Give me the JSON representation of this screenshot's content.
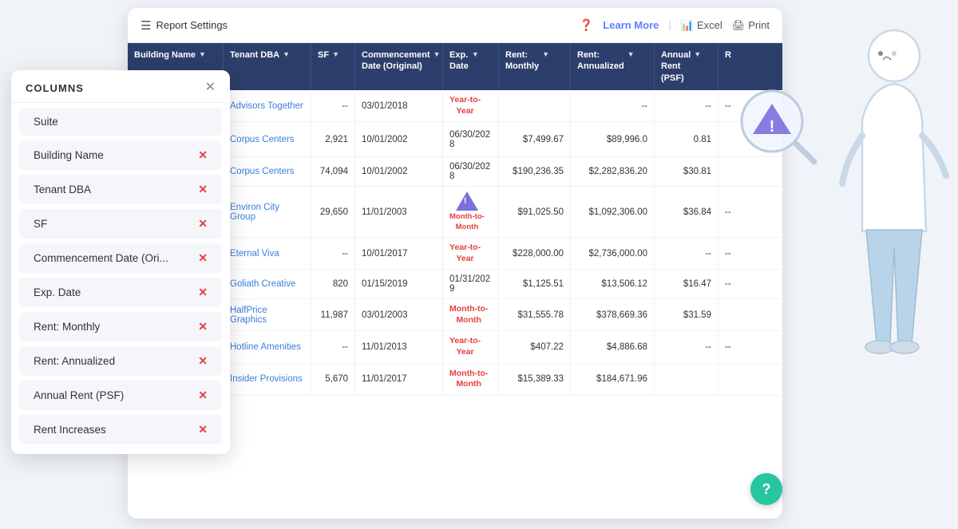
{
  "header": {
    "settings_label": "Report Settings",
    "learn_more": "Learn More",
    "excel": "Excel",
    "print": "Print"
  },
  "columns_panel": {
    "title": "COLUMNS",
    "items": [
      {
        "label": "Suite"
      },
      {
        "label": "Building Name"
      },
      {
        "label": "Tenant DBA"
      },
      {
        "label": "SF"
      },
      {
        "label": "Commencement Date (Ori..."
      },
      {
        "label": "Exp. Date"
      },
      {
        "label": "Rent: Monthly"
      },
      {
        "label": "Rent: Annualized"
      },
      {
        "label": "Annual Rent (PSF)"
      },
      {
        "label": "Rent Increases"
      }
    ]
  },
  "table": {
    "columns": [
      {
        "label": "Building Name",
        "class": "col-building"
      },
      {
        "label": "Tenant DBA",
        "class": "col-tenant"
      },
      {
        "label": "SF",
        "class": "col-sf"
      },
      {
        "label": "Commencement Date (Original)",
        "class": "col-comm"
      },
      {
        "label": "Exp. Date",
        "class": "col-exp"
      },
      {
        "label": "Rent: Monthly",
        "class": "col-monthly"
      },
      {
        "label": "Rent: Annualized",
        "class": "col-annual"
      },
      {
        "label": "Annual Rent (PSF)",
        "class": "col-psf"
      },
      {
        "label": "R",
        "class": "col-ri"
      }
    ],
    "rows": [
      {
        "building": "",
        "tenant": "Advisors Together",
        "sf": "--",
        "comm": "03/01/2018",
        "exp": "",
        "monthly": "",
        "annualized": "--",
        "psf": "--",
        "ri": "--",
        "exp_special": "Year-to-Year"
      },
      {
        "building": "",
        "tenant": "Corpus Centers",
        "sf": "2,921",
        "comm": "10/01/2002",
        "exp": "06/30/2028",
        "monthly": "$7,499.67",
        "annualized": "$89,996.0",
        "psf": "0.81",
        "ri": "",
        "has_warn": true
      },
      {
        "building": "",
        "tenant": "Corpus Centers",
        "sf": "74,094",
        "comm": "10/01/2002",
        "exp": "06/30/2028",
        "monthly": "$190,236.35",
        "annualized": "$2,282,836.20",
        "psf": "$30.81",
        "ri": "",
        "exp_special": ""
      },
      {
        "building": "",
        "tenant": "Environ City Group",
        "sf": "29,650",
        "comm": "11/01/2003",
        "exp": "",
        "monthly": "$91,025.50",
        "annualized": "$1,092,306.00",
        "psf": "$36.84",
        "ri": "--",
        "exp_special": "Month-to-Month",
        "has_warn_exp": true
      },
      {
        "building": "",
        "tenant": "Eternal Viva",
        "sf": "--",
        "comm": "10/01/2017",
        "exp": "",
        "monthly": "$228,000.00",
        "annualized": "$2,736,000.00",
        "psf": "--",
        "ri": "--",
        "exp_special": "Year-to-Year"
      },
      {
        "building": "",
        "tenant": "Goliath Creative",
        "sf": "820",
        "comm": "01/15/2019",
        "exp": "01/31/2029",
        "monthly": "$1,125.51",
        "annualized": "$13,506.12",
        "psf": "$16.47",
        "ri": "--"
      },
      {
        "building": "",
        "tenant": "HalfPrice Graphics",
        "sf": "11,987",
        "comm": "03/01/2003",
        "exp": "",
        "monthly": "$31,555.78",
        "annualized": "$378,669.36",
        "psf": "$31.59",
        "ri": "",
        "exp_special": "Month-to-Month"
      },
      {
        "building": "",
        "tenant": "Hotline Amenities",
        "sf": "--",
        "comm": "11/01/2013",
        "exp": "",
        "monthly": "$407.22",
        "annualized": "$4,886.68",
        "psf": "--",
        "ri": "--",
        "exp_special": "Year-to-Year"
      },
      {
        "building": "",
        "tenant": "Insider Provisions",
        "sf": "5,670",
        "comm": "11/01/2017",
        "exp": "",
        "monthly": "$15,389.33",
        "annualized": "$184,671.96",
        "psf": "",
        "ri": "",
        "exp_special": "Month-to-Month"
      }
    ]
  }
}
